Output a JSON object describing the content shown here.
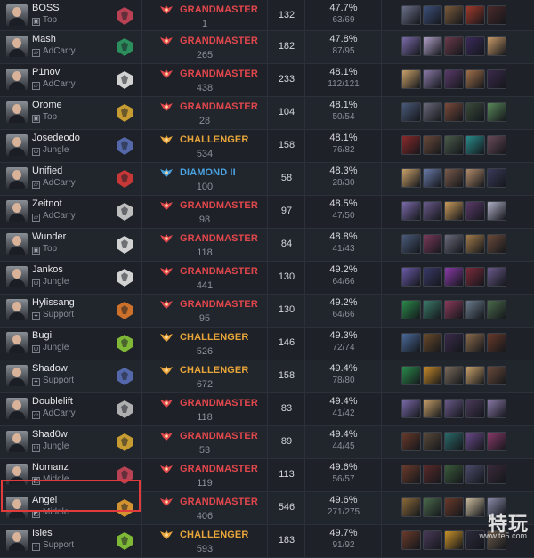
{
  "rows": [
    {
      "name": "BOSS",
      "role": "Top",
      "team_color": "#c9455a",
      "rank": "GRANDMASTER",
      "rank_color": "#e0474c",
      "lp": "1",
      "games": "132",
      "wr": "47.7%",
      "record": "63/69",
      "champs": [
        "#6a6f88",
        "#3d4f7a",
        "#7a5a3a",
        "#a03a2a",
        "#4a2a2a"
      ]
    },
    {
      "name": "Mash",
      "role": "AdCarry",
      "team_color": "#2f9a63",
      "rank": "GRANDMASTER",
      "rank_color": "#e0474c",
      "lp": "265",
      "games": "182",
      "wr": "47.8%",
      "record": "87/95",
      "champs": [
        "#7a6aa8",
        "#b0a0c8",
        "#6a3a4a",
        "#3a2a5a",
        "#c89a6a"
      ]
    },
    {
      "name": "P1nov",
      "role": "AdCarry",
      "team_color": "#e6e6e6",
      "rank": "GRANDMASTER",
      "rank_color": "#e0474c",
      "lp": "438",
      "games": "233",
      "wr": "48.1%",
      "record": "112/121",
      "champs": [
        "#c8a06a",
        "#8a7aa8",
        "#5a3a6a",
        "#a0704a",
        "#3a2a4a"
      ]
    },
    {
      "name": "Orome",
      "role": "Top",
      "team_color": "#d8a832",
      "rank": "GRANDMASTER",
      "rank_color": "#e0474c",
      "lp": "28",
      "games": "104",
      "wr": "48.1%",
      "record": "50/54",
      "champs": [
        "#4a5a7a",
        "#6a6a7a",
        "#7a4a3a",
        "#3a4a3a",
        "#5a8a5a"
      ]
    },
    {
      "name": "Josedeodo",
      "role": "Jungle",
      "team_color": "#5a6fb8",
      "rank": "CHALLENGER",
      "rank_color": "#e8a53a",
      "lp": "534",
      "games": "158",
      "wr": "48.1%",
      "record": "76/82",
      "champs": [
        "#8a2a2a",
        "#6a4a3a",
        "#4a5a4a",
        "#2a8a8a",
        "#6a4a5a"
      ]
    },
    {
      "name": "Unified",
      "role": "AdCarry",
      "team_color": "#d83a3a",
      "rank": "DIAMOND II",
      "rank_color": "#4aa3e0",
      "lp": "100",
      "games": "58",
      "wr": "48.3%",
      "record": "28/30",
      "champs": [
        "#c8a06a",
        "#6a7aa8",
        "#7a5a4a",
        "#b08a6a",
        "#3a3a5a"
      ]
    },
    {
      "name": "Zeitnot",
      "role": "AdCarry",
      "team_color": "#cfcfcf",
      "rank": "GRANDMASTER",
      "rank_color": "#e0474c",
      "lp": "98",
      "games": "97",
      "wr": "48.5%",
      "record": "47/50",
      "champs": [
        "#7a6aa8",
        "#6a5a8a",
        "#c89a5a",
        "#5a3a6a",
        "#b0b0c8"
      ]
    },
    {
      "name": "Wunder",
      "role": "Top",
      "team_color": "#e6e6e6",
      "rank": "GRANDMASTER",
      "rank_color": "#e0474c",
      "lp": "118",
      "games": "84",
      "wr": "48.8%",
      "record": "41/43",
      "champs": [
        "#4a5a7a",
        "#7a3a5a",
        "#6a6a7a",
        "#a07a4a",
        "#6a4a3a"
      ]
    },
    {
      "name": "Jankos",
      "role": "Jungle",
      "team_color": "#e6e6e6",
      "rank": "GRANDMASTER",
      "rank_color": "#e0474c",
      "lp": "441",
      "games": "130",
      "wr": "49.2%",
      "record": "64/66",
      "champs": [
        "#6a5aa8",
        "#3a3a6a",
        "#8a3aa8",
        "#7a2a3a",
        "#6a5a8a"
      ]
    },
    {
      "name": "Hylissang",
      "role": "Support",
      "team_color": "#e07a2a",
      "rank": "GRANDMASTER",
      "rank_color": "#e0474c",
      "lp": "95",
      "games": "130",
      "wr": "49.2%",
      "record": "64/66",
      "champs": [
        "#2a8a4a",
        "#3a7a6a",
        "#8a3a5a",
        "#6a7a8a",
        "#4a6a4a"
      ]
    },
    {
      "name": "Bugi",
      "role": "Jungle",
      "team_color": "#8ac83a",
      "rank": "CHALLENGER",
      "rank_color": "#e8a53a",
      "lp": "526",
      "games": "146",
      "wr": "49.3%",
      "record": "72/74",
      "champs": [
        "#4a6a9a",
        "#6a4a2a",
        "#3a2a4a",
        "#8a6a4a",
        "#6a3a2a"
      ]
    },
    {
      "name": "Shadow",
      "role": "Support",
      "team_color": "#5a6fb8",
      "rank": "CHALLENGER",
      "rank_color": "#e8a53a",
      "lp": "672",
      "games": "158",
      "wr": "49.4%",
      "record": "78/80",
      "champs": [
        "#2a8a4a",
        "#c88a2a",
        "#7a6a5a",
        "#c8a06a",
        "#6a4a3a"
      ]
    },
    {
      "name": "Doublelift",
      "role": "AdCarry",
      "team_color": "#bfbfbf",
      "rank": "GRANDMASTER",
      "rank_color": "#e0474c",
      "lp": "118",
      "games": "83",
      "wr": "49.4%",
      "record": "41/42",
      "champs": [
        "#7a6aa8",
        "#c8a06a",
        "#6a5a8a",
        "#4a3a5a",
        "#8a7aa8"
      ]
    },
    {
      "name": "Shad0w",
      "role": "Jungle",
      "team_color": "#d8a832",
      "rank": "GRANDMASTER",
      "rank_color": "#e0474c",
      "lp": "53",
      "games": "89",
      "wr": "49.4%",
      "record": "44/45",
      "champs": [
        "#6a3a2a",
        "#5a4a3a",
        "#2a6a6a",
        "#6a4a8a",
        "#8a3a6a"
      ]
    },
    {
      "name": "Nomanz",
      "role": "Middle",
      "team_color": "#c9455a",
      "rank": "GRANDMASTER",
      "rank_color": "#e0474c",
      "lp": "119",
      "games": "113",
      "wr": "49.6%",
      "record": "56/57",
      "champs": [
        "#6a3a2a",
        "#5a2a2a",
        "#3a5a3a",
        "#4a4a6a",
        "#3a2a3a"
      ]
    },
    {
      "name": "Angel",
      "role": "Middle",
      "team_color": "#e8a032",
      "rank": "GRANDMASTER",
      "rank_color": "#e0474c",
      "lp": "406",
      "games": "546",
      "wr": "49.6%",
      "record": "271/275",
      "champs": [
        "#8a6a3a",
        "#4a6a4a",
        "#6a3a2a",
        "#c8b89a",
        "#8a8aa8"
      ]
    },
    {
      "name": "Isles",
      "role": "Support",
      "team_color": "#8ac83a",
      "rank": "CHALLENGER",
      "rank_color": "#e8a53a",
      "lp": "593",
      "games": "183",
      "wr": "49.7%",
      "record": "91/92",
      "champs": [
        "#6a3a2a",
        "#4a3a5a",
        "#c8902a",
        "#2a2a3a",
        "#6a5a4a"
      ]
    }
  ],
  "role_glyphs": {
    "Top": "▣",
    "AdCarry": "▱",
    "Jungle": "ψ",
    "Support": "✦",
    "Middle": "◩"
  },
  "watermark": {
    "main": "特玩",
    "url": "www.te5.com"
  }
}
